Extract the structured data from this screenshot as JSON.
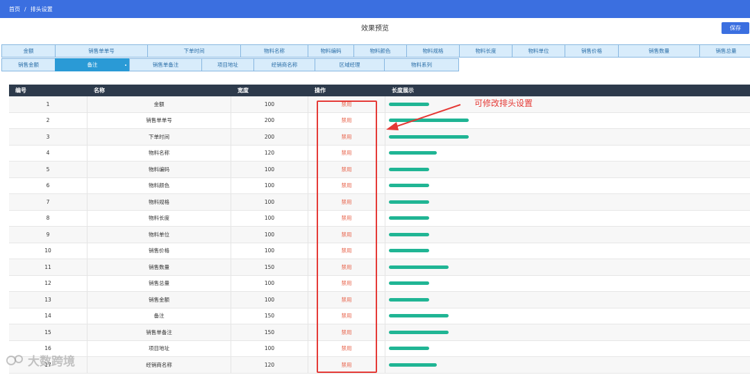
{
  "breadcrumb": {
    "home": "首页",
    "separator": "/",
    "current": "排头设置"
  },
  "preview": {
    "title": "效果预览",
    "save_label": "保存"
  },
  "header_row1": [
    {
      "label": "金额",
      "active": false
    },
    {
      "label": "销售单单号",
      "active": false
    },
    {
      "label": "下单时间",
      "active": false
    },
    {
      "label": "物料名称",
      "active": false
    },
    {
      "label": "物料编码",
      "active": false
    },
    {
      "label": "物料颜色",
      "active": false
    },
    {
      "label": "物料规格",
      "active": false
    },
    {
      "label": "物料长度",
      "active": false
    },
    {
      "label": "物料单位",
      "active": false
    },
    {
      "label": "销售价格",
      "active": false
    },
    {
      "label": "销售数量",
      "active": false
    },
    {
      "label": "销售总量",
      "active": false
    }
  ],
  "header_row2": [
    {
      "label": "销售金额",
      "active": false
    },
    {
      "label": "备注",
      "active": true
    },
    {
      "label": "销售单备注",
      "active": false
    },
    {
      "label": "项目地址",
      "active": false
    },
    {
      "label": "经销商名称",
      "active": false
    },
    {
      "label": "区域经理",
      "active": false
    },
    {
      "label": "物料系列",
      "active": false
    }
  ],
  "table": {
    "columns": [
      "编号",
      "名称",
      "宽度",
      "操作",
      "长度展示"
    ],
    "action_label": "禁用",
    "rows": [
      {
        "no": "1",
        "name": "金额",
        "width": "100",
        "bar_width": 100
      },
      {
        "no": "2",
        "name": "销售单单号",
        "width": "200",
        "bar_width": 200
      },
      {
        "no": "3",
        "name": "下单时间",
        "width": "200",
        "bar_width": 200
      },
      {
        "no": "4",
        "name": "物料名称",
        "width": "120",
        "bar_width": 120
      },
      {
        "no": "5",
        "name": "物料编码",
        "width": "100",
        "bar_width": 100
      },
      {
        "no": "6",
        "name": "物料颜色",
        "width": "100",
        "bar_width": 100
      },
      {
        "no": "7",
        "name": "物料规格",
        "width": "100",
        "bar_width": 100
      },
      {
        "no": "8",
        "name": "物料长度",
        "width": "100",
        "bar_width": 100
      },
      {
        "no": "9",
        "name": "物料单位",
        "width": "100",
        "bar_width": 100
      },
      {
        "no": "10",
        "name": "销售价格",
        "width": "100",
        "bar_width": 100
      },
      {
        "no": "11",
        "name": "销售数量",
        "width": "150",
        "bar_width": 150
      },
      {
        "no": "12",
        "name": "销售总量",
        "width": "100",
        "bar_width": 100
      },
      {
        "no": "13",
        "name": "销售金额",
        "width": "100",
        "bar_width": 100
      },
      {
        "no": "14",
        "name": "备注",
        "width": "150",
        "bar_width": 150
      },
      {
        "no": "15",
        "name": "销售单备注",
        "width": "150",
        "bar_width": 150
      },
      {
        "no": "16",
        "name": "项目地址",
        "width": "100",
        "bar_width": 100
      },
      {
        "no": "17",
        "name": "经销商名称",
        "width": "120",
        "bar_width": 120
      }
    ]
  },
  "annotation": {
    "text": "可修改排头设置"
  },
  "watermark": {
    "text": "大数跨境"
  },
  "colors": {
    "primary": "#3b6fe0",
    "bar": "#20b594",
    "danger": "#e53935",
    "table_header": "#2d3a4b"
  }
}
